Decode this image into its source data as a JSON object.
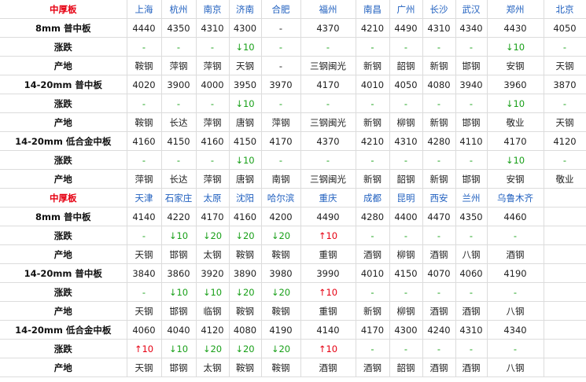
{
  "colors": {
    "section_title": "#e60012",
    "city_header": "#1f5fbf",
    "rise": "#e60012",
    "fall": "#19a019",
    "grid": "#dcdcdc"
  },
  "tables": [
    {
      "title": "中厚板",
      "cities": [
        "上海",
        "杭州",
        "南京",
        "济南",
        "合肥",
        "福州",
        "南昌",
        "广州",
        "长沙",
        "武汉",
        "郑州",
        "北京"
      ],
      "rows": [
        {
          "label": "8mm 普中板",
          "kind": "price",
          "cells": [
            "4440",
            "4350",
            "4310",
            "4300",
            "-",
            "4370",
            "4210",
            "4490",
            "4310",
            "4340",
            "4430",
            "4050"
          ]
        },
        {
          "label": "涨跌",
          "kind": "change",
          "cells": [
            "-",
            "-",
            "-",
            "↓10",
            "-",
            "-",
            "-",
            "-",
            "-",
            "-",
            "↓10",
            "-"
          ]
        },
        {
          "label": "产地",
          "kind": "origin",
          "cells": [
            "鞍钢",
            "萍钢",
            "萍钢",
            "天钢",
            "-",
            "三钢闽光",
            "新钢",
            "韶钢",
            "新钢",
            "邯钢",
            "安钢",
            "天钢"
          ]
        },
        {
          "label": "14-20mm 普中板",
          "kind": "price",
          "cells": [
            "4020",
            "3900",
            "4000",
            "3950",
            "3970",
            "4170",
            "4010",
            "4050",
            "4080",
            "3940",
            "3960",
            "3870"
          ]
        },
        {
          "label": "涨跌",
          "kind": "change",
          "cells": [
            "-",
            "-",
            "-",
            "↓10",
            "-",
            "-",
            "-",
            "-",
            "-",
            "-",
            "↓10",
            "-"
          ]
        },
        {
          "label": "产地",
          "kind": "origin",
          "cells": [
            "鞍钢",
            "长达",
            "萍钢",
            "唐钢",
            "萍钢",
            "三钢闽光",
            "新钢",
            "柳钢",
            "新钢",
            "邯钢",
            "敬业",
            "天钢"
          ]
        },
        {
          "label": "14-20mm 低合金中板",
          "kind": "price",
          "cells": [
            "4160",
            "4150",
            "4160",
            "4150",
            "4170",
            "4370",
            "4210",
            "4310",
            "4280",
            "4110",
            "4170",
            "4120"
          ]
        },
        {
          "label": "涨跌",
          "kind": "change",
          "cells": [
            "-",
            "-",
            "-",
            "↓10",
            "-",
            "-",
            "-",
            "-",
            "-",
            "-",
            "↓10",
            "-"
          ]
        },
        {
          "label": "产地",
          "kind": "origin",
          "cells": [
            "萍钢",
            "长达",
            "萍钢",
            "唐钢",
            "南钢",
            "三钢闽光",
            "新钢",
            "韶钢",
            "新钢",
            "邯钢",
            "安钢",
            "敬业"
          ]
        }
      ]
    },
    {
      "title": "中厚板",
      "cities": [
        "天津",
        "石家庄",
        "太原",
        "沈阳",
        "哈尔滨",
        "重庆",
        "成都",
        "昆明",
        "西安",
        "兰州",
        "乌鲁木齐",
        ""
      ],
      "rows": [
        {
          "label": "8mm 普中板",
          "kind": "price",
          "cells": [
            "4140",
            "4220",
            "4170",
            "4160",
            "4200",
            "4490",
            "4280",
            "4400",
            "4470",
            "4350",
            "4460",
            ""
          ]
        },
        {
          "label": "涨跌",
          "kind": "change",
          "cells": [
            "-",
            "↓10",
            "↓20",
            "↓20",
            "↓20",
            "↑10",
            "-",
            "-",
            "-",
            "-",
            "-",
            ""
          ]
        },
        {
          "label": "产地",
          "kind": "origin",
          "cells": [
            "天钢",
            "邯钢",
            "太钢",
            "鞍钢",
            "鞍钢",
            "重钢",
            "酒钢",
            "柳钢",
            "酒钢",
            "八钢",
            "酒钢",
            ""
          ]
        },
        {
          "label": "14-20mm 普中板",
          "kind": "price",
          "cells": [
            "3840",
            "3860",
            "3920",
            "3890",
            "3980",
            "3990",
            "4010",
            "4150",
            "4070",
            "4060",
            "4190",
            ""
          ]
        },
        {
          "label": "涨跌",
          "kind": "change",
          "cells": [
            "-",
            "↓10",
            "↓10",
            "↓20",
            "↓20",
            "↑10",
            "-",
            "-",
            "-",
            "-",
            "-",
            ""
          ]
        },
        {
          "label": "产地",
          "kind": "origin",
          "cells": [
            "天钢",
            "邯钢",
            "临钢",
            "鞍钢",
            "鞍钢",
            "重钢",
            "新钢",
            "柳钢",
            "酒钢",
            "酒钢",
            "八钢",
            ""
          ]
        },
        {
          "label": "14-20mm 低合金中板",
          "kind": "price",
          "cells": [
            "4060",
            "4040",
            "4120",
            "4080",
            "4190",
            "4140",
            "4170",
            "4300",
            "4240",
            "4310",
            "4340",
            ""
          ]
        },
        {
          "label": "涨跌",
          "kind": "change",
          "cells": [
            "↑10",
            "↓10",
            "↓20",
            "↓20",
            "↓20",
            "↑10",
            "-",
            "-",
            "-",
            "-",
            "-",
            ""
          ]
        },
        {
          "label": "产地",
          "kind": "origin",
          "cells": [
            "天钢",
            "邯钢",
            "太钢",
            "鞍钢",
            "鞍钢",
            "酒钢",
            "酒钢",
            "韶钢",
            "酒钢",
            "酒钢",
            "八钢",
            ""
          ]
        }
      ]
    }
  ]
}
